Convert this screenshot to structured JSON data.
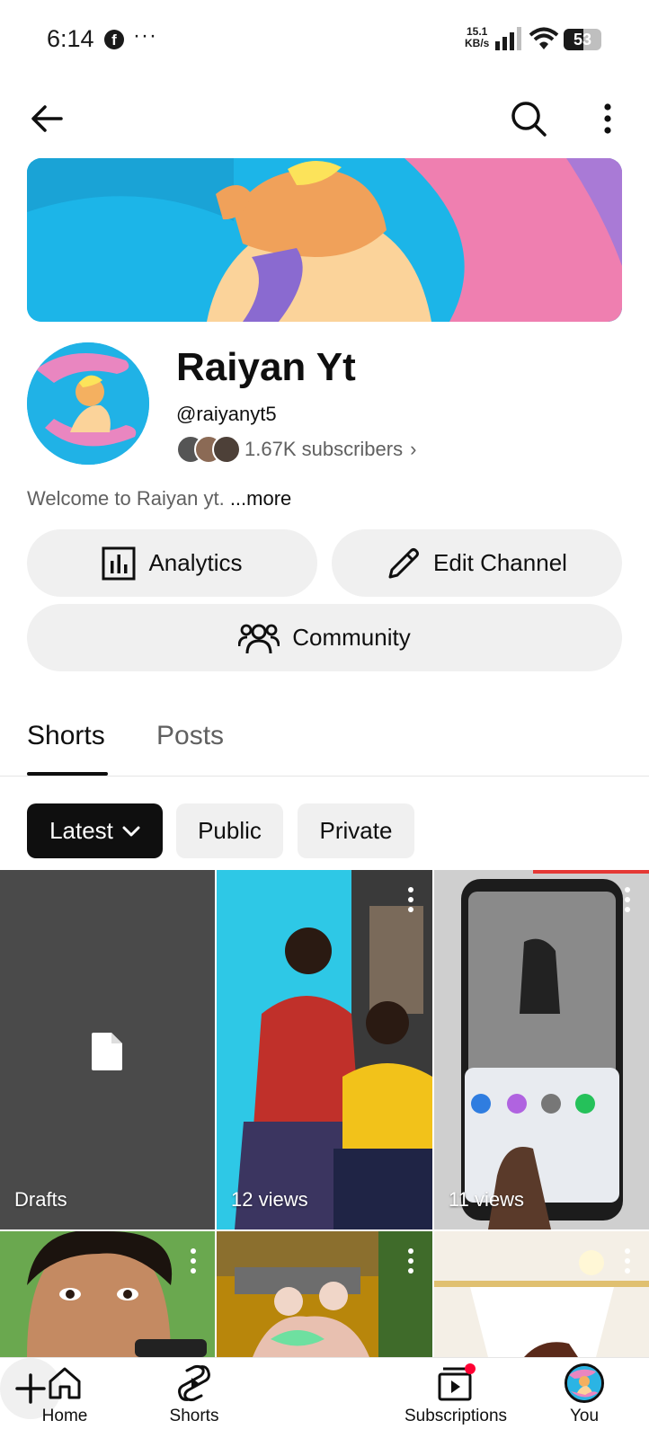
{
  "status_bar": {
    "time": "6:14",
    "fb_icon": "f",
    "dots": "···",
    "speed_value": "15.1",
    "speed_unit": "KB/s",
    "battery": "53"
  },
  "channel": {
    "name": "Raiyan Yt",
    "handle": "@raiyanyt5",
    "subscribers": "1.67K subscribers",
    "subscribers_chevron": "›",
    "description": "Welcome to Raiyan yt.",
    "more_label": "...more"
  },
  "actions": {
    "analytics_label": "Analytics",
    "edit_label": "Edit Channel",
    "community_label": "Community"
  },
  "tabs": {
    "shorts": "Shorts",
    "posts": "Posts"
  },
  "filters": {
    "latest": "Latest",
    "public": "Public",
    "private": "Private"
  },
  "grid": {
    "drafts_label": "Drafts",
    "items": [
      {
        "views": "12 views"
      },
      {
        "views": "11 views"
      }
    ]
  },
  "bottom_nav": {
    "home": "Home",
    "shorts": "Shorts",
    "subscriptions": "Subscriptions",
    "you": "You"
  },
  "colors": {
    "accent_dark": "#0f0f0f",
    "chip_bg": "#f0f0f0",
    "notification_dot": "#ff0033"
  },
  "icons": [
    "back-arrow-icon",
    "search-icon",
    "more-vert-icon",
    "analytics-icon",
    "pencil-icon",
    "community-icon",
    "chevron-down-icon",
    "document-icon",
    "home-icon",
    "shorts-icon",
    "plus-icon",
    "subscriptions-icon"
  ]
}
